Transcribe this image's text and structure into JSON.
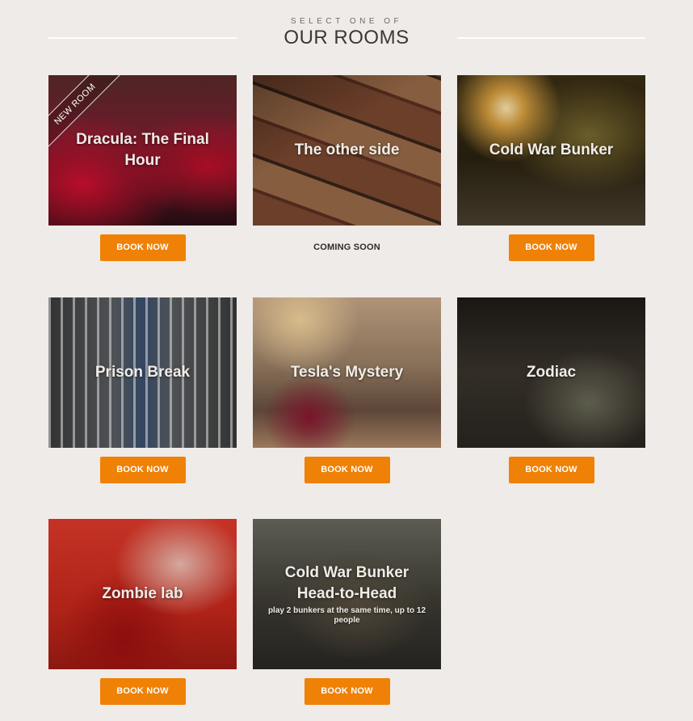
{
  "header": {
    "subtitle": "SELECT ONE OF",
    "title": "OUR ROOMS"
  },
  "rooms": [
    {
      "name": "Dracula: The Final Hour",
      "ribbon": "NEW ROOM",
      "action": "BOOK NOW"
    },
    {
      "name": "The other side",
      "action": "COMING SOON"
    },
    {
      "name": "Cold War Bunker",
      "action": "BOOK NOW"
    },
    {
      "name": "Prison Break",
      "action": "BOOK NOW"
    },
    {
      "name": "Tesla's Mystery",
      "action": "BOOK NOW"
    },
    {
      "name": "Zodiac",
      "action": "BOOK NOW"
    },
    {
      "name": "Zombie lab",
      "action": "BOOK NOW"
    },
    {
      "name": "Cold War Bunker Head-to-Head",
      "note": "play 2 bunkers at the same time, up to 12 people",
      "action": "BOOK NOW"
    }
  ],
  "colors": {
    "background": "#efebe8",
    "accent": "#ee8106",
    "title": "#3a3836"
  }
}
